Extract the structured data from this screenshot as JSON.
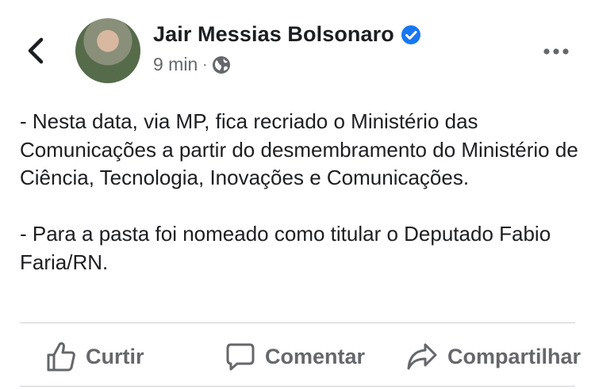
{
  "header": {
    "author_name": "Jair Messias Bolsonaro",
    "timestamp": "9 min",
    "separator": "·",
    "icons": {
      "back": "chevron-left-icon",
      "verified": "verified-badge-icon",
      "audience": "globe-icon",
      "more": "more-options-icon"
    },
    "colors": {
      "verified": "#1877f2",
      "secondary_text": "#65676b"
    }
  },
  "post": {
    "paragraphs": [
      "- Nesta data, via MP, fica recriado o Ministério das Comunicações a partir do desmembramento do Ministério de Ciência, Tecnologia, Inovações e Comunicações.",
      "- Para a pasta foi nomeado como titular o Deputado Fabio Faria/RN."
    ]
  },
  "actions": {
    "like_label": "Curtir",
    "comment_label": "Comentar",
    "share_label": "Compartilhar"
  }
}
